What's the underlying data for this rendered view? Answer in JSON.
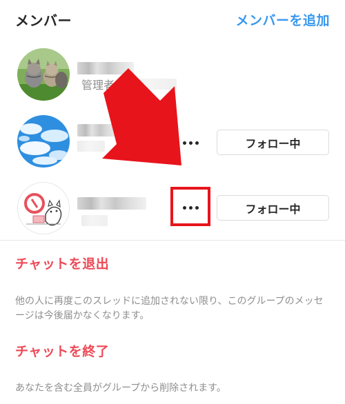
{
  "header": {
    "title": "メンバー",
    "add_member_label": "メンバーを追加",
    "accent_color": "#3897f0"
  },
  "members": [
    {
      "avatar_icon": "kittens-photo-avatar",
      "name_blurred": true,
      "role": "管理者"
    },
    {
      "avatar_icon": "sky-clouds-avatar",
      "name_blurred": true,
      "more_icon": "more-options-icon",
      "follow_label": "フォロー中"
    },
    {
      "avatar_icon": "cat-illustration-avatar",
      "name_blurred": true,
      "more_icon": "more-options-icon",
      "follow_label": "フォロー中",
      "highlighted": true
    }
  ],
  "actions": {
    "leave_chat_label": "チャットを退出",
    "leave_chat_desc": "他の人に再度このスレッドに追加されない限り、このグループのメッセージは今後届かなくなります。",
    "end_chat_label": "チャットを終了",
    "end_chat_desc": "あなたを含む全員がグループから削除されます。",
    "danger_color": "#ed4956"
  },
  "annotation": {
    "arrow_color": "#e8141b",
    "highlight_color": "#e8141b"
  }
}
